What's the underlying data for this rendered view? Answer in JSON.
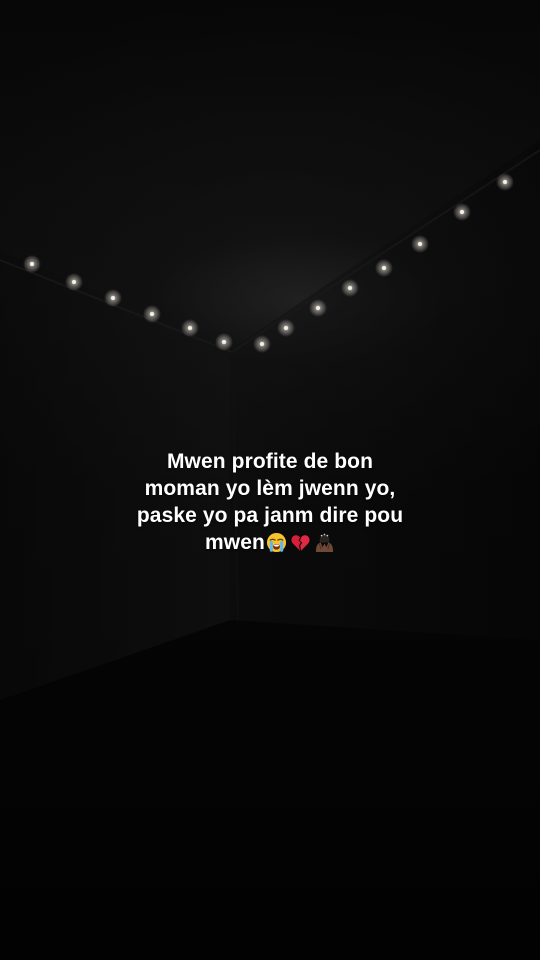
{
  "caption": {
    "line1": "Mwen profite de bon",
    "line2": "moman yo lèm jwenn yo,",
    "line3": "paske yo pa janm dire pou",
    "line4": "mwen"
  },
  "emojis": [
    "loudly-crying-face",
    "broken-heart",
    "face-in-hands"
  ],
  "colors": {
    "background": "#030303",
    "text": "#ffffff",
    "light_glow": "#f5f0e6"
  }
}
